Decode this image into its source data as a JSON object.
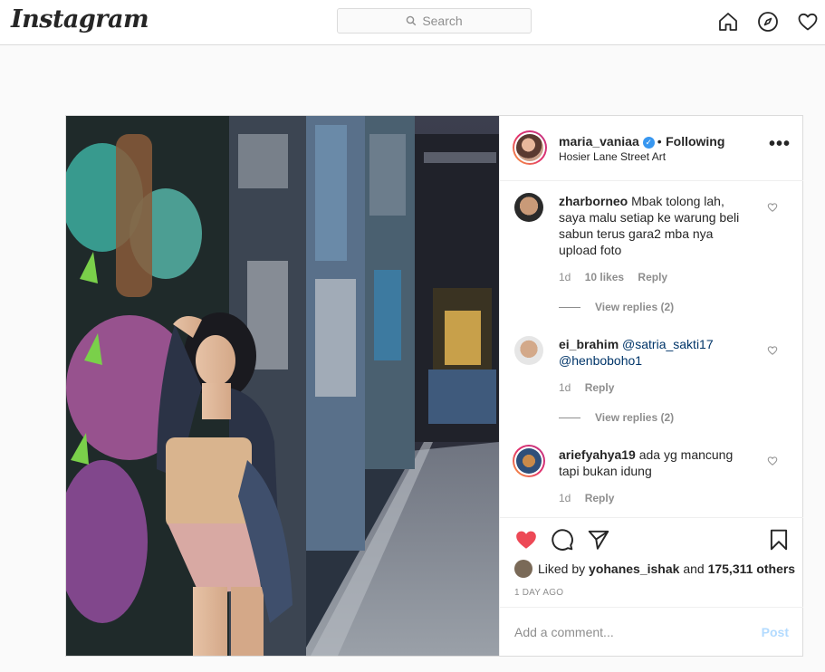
{
  "header": {
    "logo": "Instagram",
    "search": {
      "placeholder": "Search"
    }
  },
  "post": {
    "author": "maria_vaniaa",
    "verified": true,
    "follow_status": "Following",
    "separator": "•",
    "location": "Hosier Lane Street Art",
    "more_label": "•••",
    "comments": [
      {
        "username": "zharborneo",
        "text": "Mbak tolong lah, saya malu setiap ke warung beli sabun terus gara2 mba nya upload foto",
        "age": "1d",
        "likes": "10 likes",
        "reply_label": "Reply",
        "view_replies": "View replies (2)"
      },
      {
        "username": "ei_brahim",
        "mentions": [
          "@satria_sakti17",
          "@henboboho1"
        ],
        "age": "1d",
        "reply_label": "Reply",
        "view_replies": "View replies (2)"
      },
      {
        "username": "ariefyahya19",
        "text": "ada yg mancung tapi bukan idung",
        "age": "1d",
        "reply_label": "Reply"
      }
    ],
    "liked_by": {
      "prefix": "Liked by",
      "user": "yohanes_ishak",
      "and": "and",
      "others": "175,311 others"
    },
    "time_ago": "1 DAY AGO",
    "add_comment": {
      "placeholder": "Add a comment...",
      "post_label": "Post"
    }
  },
  "colors": {
    "like_red": "#ed4956",
    "link_blue": "#003569",
    "verified_blue": "#3897f0",
    "post_disabled": "#b3dbff"
  }
}
